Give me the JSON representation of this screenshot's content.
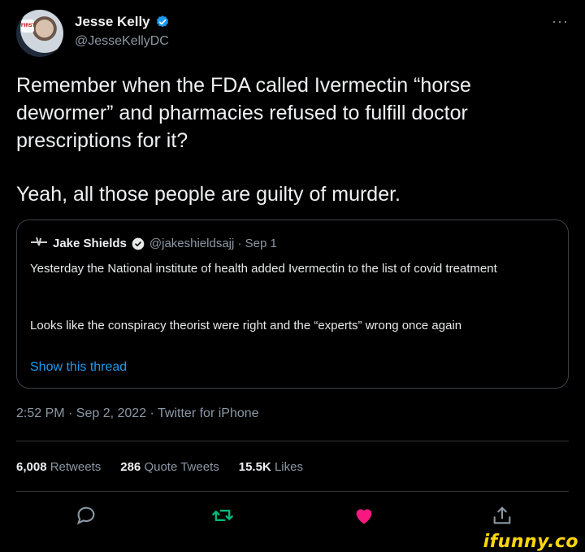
{
  "author": {
    "name": "Jesse Kelly",
    "handle": "@JesseKellyDC",
    "avatar_badge": "FIRST"
  },
  "tweet": {
    "paragraph1": "Remember when the FDA called Ivermectin “horse dewormer” and pharmacies refused to fulfill doctor prescriptions for it?",
    "paragraph2": "Yeah, all those people are guilty of murder.",
    "timestamp_line": "2:52 PM · Sep 2, 2022 · Twitter for iPhone"
  },
  "quoted": {
    "name": "Jake Shields",
    "handle_date": "@jakeshieldsajj · Sep 1",
    "text1": "Yesterday the National institute of health added Ivermectin to the list of covid treatment",
    "text2": "Looks like the conspiracy theorist were right  and the “experts” wrong once again",
    "show_thread": "Show this thread"
  },
  "stats": {
    "retweets_count": "6,008",
    "retweets_label": "Retweets",
    "quotes_count": "286",
    "quotes_label": "Quote Tweets",
    "likes_count": "15.5K",
    "likes_label": "Likes"
  },
  "more_label": "···",
  "watermark": "ifunny.co",
  "colors": {
    "background": "#000000",
    "link": "#1d9bf0",
    "retweet_green": "#00ba7c",
    "like_pink": "#f91880",
    "muted": "#8b98a5",
    "watermark": "#ffd60a"
  },
  "icons": [
    "verified-icon",
    "reply-icon",
    "retweet-icon",
    "like-icon",
    "share-icon",
    "more-icon"
  ]
}
